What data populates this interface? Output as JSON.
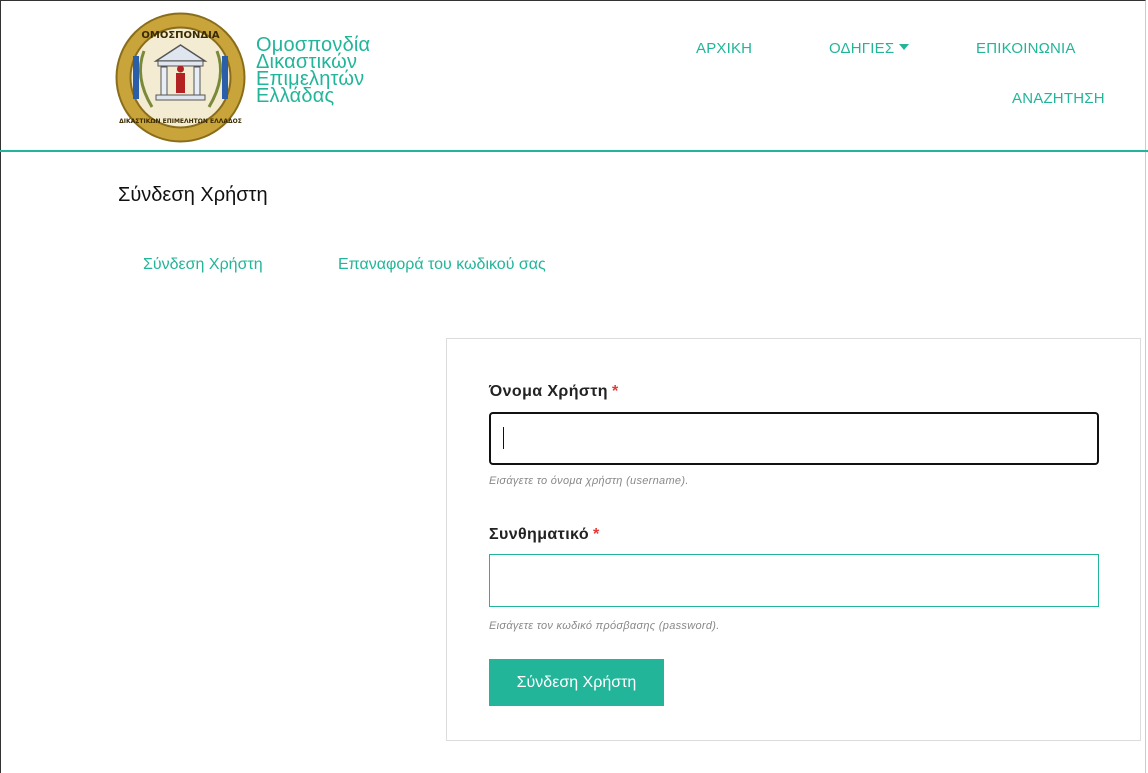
{
  "header": {
    "brand_lines": [
      "Ομοσπονδία",
      "Δικαστικών",
      "Επιμελητών",
      "Ελλάδας"
    ],
    "logo_text_top": "ΟΜΟΣΠΟΝΔΙΑ",
    "logo_text_bottom": "ΔΙΚΑΣΤΙΚΩΝ ΕΠΙΜΕΛΗΤΩΝ ΕΛΛΑΔΟΣ",
    "logo_icon": "federation-emblem-icon"
  },
  "nav": {
    "home": "ΑΡΧΙΚΗ",
    "guides": "ΟΔΗΓΙΕΣ",
    "contact": "ΕΠΙΚΟΙΝΩΝΙΑ",
    "search": "ΑΝΑΖΗΤΗΣΗ"
  },
  "page": {
    "title": "Σύνδεση Χρήστη"
  },
  "tabs": {
    "login": "Σύνδεση Χρήστη",
    "reset": "Επαναφορά του κωδικού σας"
  },
  "form": {
    "username_label": "Όνομα Χρήστη",
    "username_value": "",
    "username_hint": "Εισάγετε το όνομα χρήστη (username).",
    "password_label": "Συνθηματικό",
    "password_value": "",
    "password_hint": "Εισάγετε τον κωδικό πρόσβασης (password).",
    "required_marker": "*",
    "submit_label": "Σύνδεση Χρήστη"
  },
  "colors": {
    "accent": "#22b59a",
    "required": "#e53935"
  }
}
